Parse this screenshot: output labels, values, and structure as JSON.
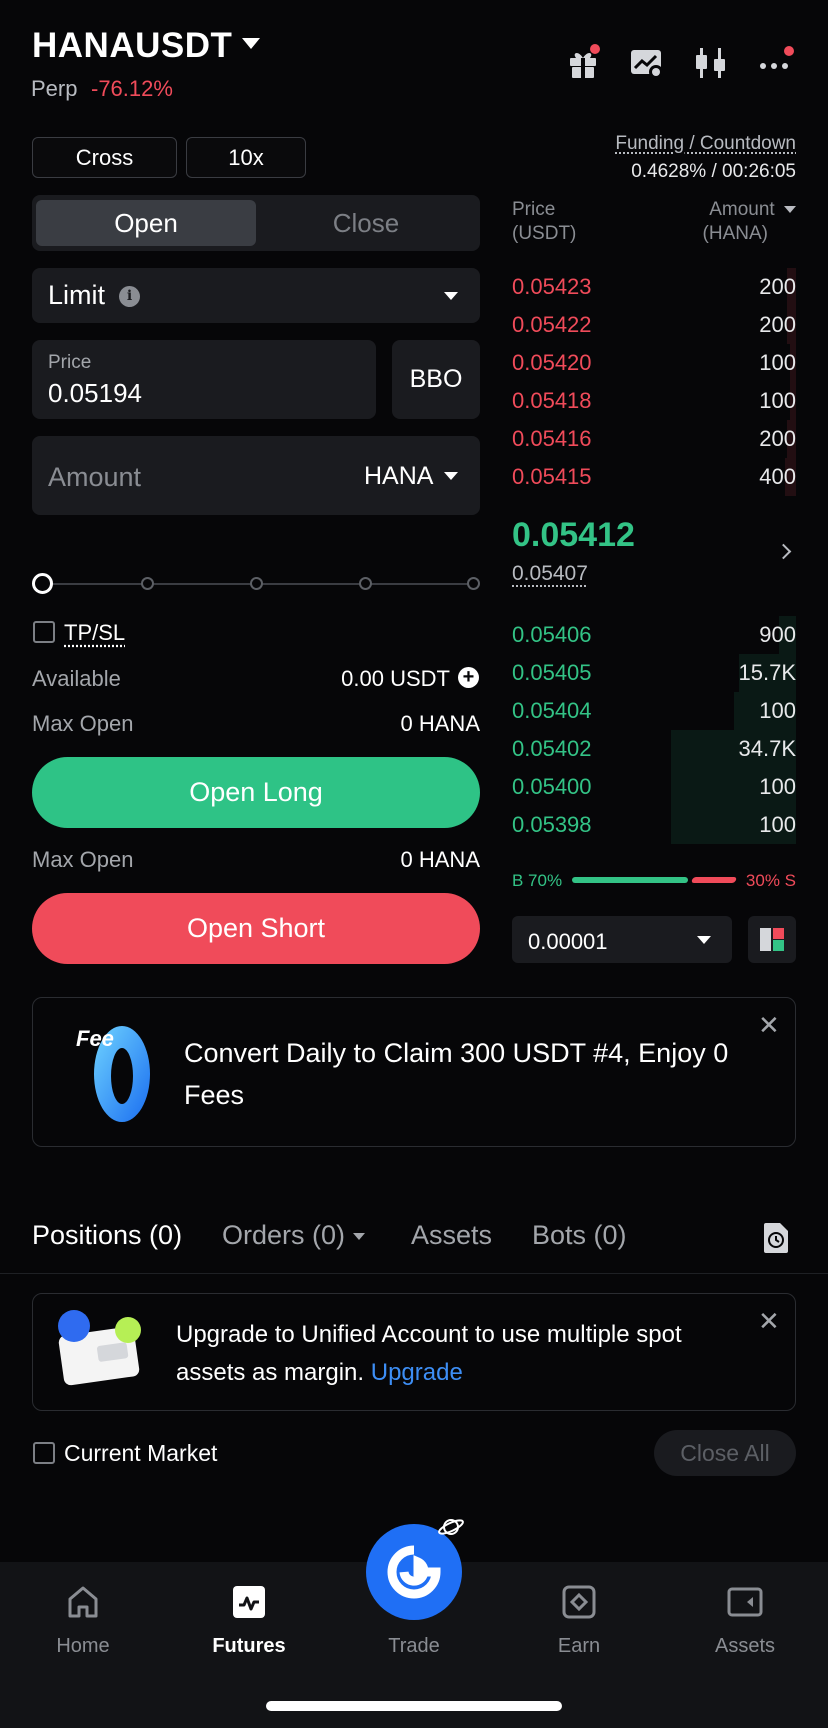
{
  "header": {
    "symbol": "HANAUSDT",
    "market_type": "Perp",
    "change": "-76.12%",
    "icons": [
      "gift-icon",
      "chart-settings-icon",
      "candlestick-icon",
      "more-icon"
    ]
  },
  "margin": {
    "mode": "Cross",
    "leverage": "10x"
  },
  "funding": {
    "label": "Funding / Countdown",
    "value": "0.4628% / 00:26:05"
  },
  "order_form": {
    "tab_open": "Open",
    "tab_close": "Close",
    "order_type": "Limit",
    "price_label": "Price",
    "price_value": "0.05194",
    "bbo_label": "BBO",
    "amount_placeholder": "Amount",
    "amount_unit": "HANA",
    "tpsl_label": "TP/SL",
    "available_label": "Available",
    "available_value": "0.00 USDT",
    "max_open_label": "Max Open",
    "max_open_long": "0 HANA",
    "max_open_short": "0 HANA",
    "open_long": "Open Long",
    "open_short": "Open Short"
  },
  "order_book": {
    "price_header": "Price",
    "price_unit": "(USDT)",
    "amount_header": "Amount",
    "amount_unit": "(HANA)",
    "asks": [
      {
        "price": "0.05423",
        "amount": "200",
        "depth": 0.03
      },
      {
        "price": "0.05422",
        "amount": "200",
        "depth": 0.03
      },
      {
        "price": "0.05420",
        "amount": "100",
        "depth": 0.02
      },
      {
        "price": "0.05418",
        "amount": "100",
        "depth": 0.02
      },
      {
        "price": "0.05416",
        "amount": "200",
        "depth": 0.03
      },
      {
        "price": "0.05415",
        "amount": "400",
        "depth": 0.04
      }
    ],
    "last_price": "0.05412",
    "mark_price": "0.05407",
    "bids": [
      {
        "price": "0.05406",
        "amount": "900",
        "depth": 0.06
      },
      {
        "price": "0.05405",
        "amount": "15.7K",
        "depth": 0.2
      },
      {
        "price": "0.05404",
        "amount": "100",
        "depth": 0.22
      },
      {
        "price": "0.05402",
        "amount": "34.7K",
        "depth": 0.44
      },
      {
        "price": "0.05400",
        "amount": "100",
        "depth": 0.44
      },
      {
        "price": "0.05398",
        "amount": "100",
        "depth": 0.44
      }
    ],
    "buy_ratio": "B 70%",
    "sell_ratio": "30% S",
    "tick_size": "0.00001"
  },
  "promo": {
    "text": "Convert Daily to Claim 300 USDT #4, Enjoy 0 Fees",
    "badge": "Fee"
  },
  "tabs": [
    "Positions (0)",
    "Orders (0)",
    "Assets",
    "Bots (0)"
  ],
  "upgrade": {
    "text": "Upgrade to Unified Account to use multiple spot assets as margin. ",
    "link": "Upgrade"
  },
  "positions": {
    "current_market": "Current Market",
    "close_all": "Close All"
  },
  "nav": [
    "Home",
    "Futures",
    "Trade",
    "Earn",
    "Assets"
  ],
  "colors": {
    "green": "#33c386",
    "red": "#f04b5a",
    "accent": "#1f6ff5"
  }
}
